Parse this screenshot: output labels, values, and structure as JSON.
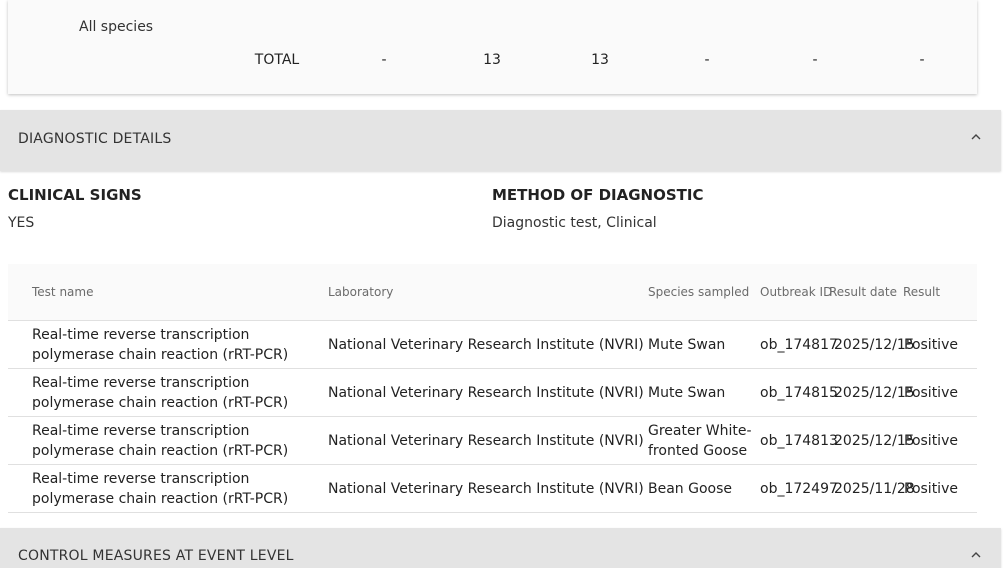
{
  "totals": {
    "species_label": "All species",
    "total_label": "TOTAL",
    "values": [
      "-",
      "13",
      "13",
      "-",
      "-",
      "-"
    ]
  },
  "diagnostic_section": {
    "title": "DIAGNOSTIC DETAILS",
    "clinical_signs_label": "CLINICAL SIGNS",
    "clinical_signs_value": "YES",
    "method_label": "METHOD OF DIAGNOSTIC",
    "method_value": "Diagnostic test, Clinical"
  },
  "diagnostic_table": {
    "headers": {
      "test_name": "Test name",
      "laboratory": "Laboratory",
      "species_sampled": "Species sampled",
      "outbreak_id": "Outbreak ID",
      "result_date": "Result date",
      "result": "Result"
    },
    "rows": [
      {
        "test_name": "Real-time reverse transcription polymerase chain reaction (rRT-PCR)",
        "laboratory": "National Veterinary Research Institute (NVRI)",
        "species": "Mute Swan",
        "outbreak_id": "ob_174817",
        "result_date": "2025/12/15",
        "result": "Positive"
      },
      {
        "test_name": "Real-time reverse transcription polymerase chain reaction (rRT-PCR)",
        "laboratory": "National Veterinary Research Institute (NVRI)",
        "species": "Mute Swan",
        "outbreak_id": "ob_174815",
        "result_date": "2025/12/15",
        "result": "Positive"
      },
      {
        "test_name": "Real-time reverse transcription polymerase chain reaction (rRT-PCR)",
        "laboratory": "National Veterinary Research Institute (NVRI)",
        "species": "Greater White-fronted Goose",
        "outbreak_id": "ob_174813",
        "result_date": "2025/12/15",
        "result": "Positive"
      },
      {
        "test_name": "Real-time reverse transcription polymerase chain reaction (rRT-PCR)",
        "laboratory": "National Veterinary Research Institute (NVRI)",
        "species": "Bean Goose",
        "outbreak_id": "ob_172497",
        "result_date": "2025/11/28",
        "result": "Positive"
      }
    ]
  },
  "control_section": {
    "title": "CONTROL MEASURES AT EVENT LEVEL"
  },
  "icons": {
    "diagnostic_toggle": "chevron-up-icon",
    "control_toggle": "chevron-up-icon"
  }
}
